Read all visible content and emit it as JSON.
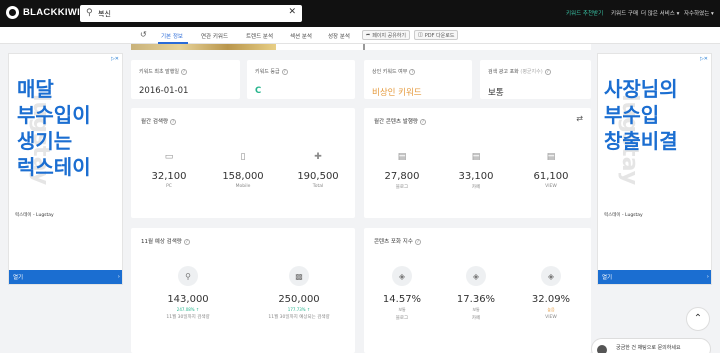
{
  "app": {
    "name": "BLACKKIWI"
  },
  "search": {
    "value": "복신",
    "placeholder": ""
  },
  "topnav": [
    {
      "label": "키워드 추천받기",
      "active": true
    },
    {
      "label": "키워드 구매"
    },
    {
      "label": "더 많은 서비스 ▾"
    },
    {
      "label": "자수하였는 ▾"
    }
  ],
  "tabs": [
    "기본 정보",
    "연관 키워드",
    "트렌드 분석",
    "섹션 분석",
    "성장 분석"
  ],
  "tab_buttons": [
    "페이지 공유하기",
    "PDF 다운로드"
  ],
  "ad_left": {
    "headline": "매달 부수입이 생기는 럭스테이",
    "headline_lines": [
      "매달",
      "부수입이",
      "생기는",
      "럭스테이"
    ],
    "sponsor": "럭스테이 - Lugstay",
    "button": "열기",
    "watermark": "lugstay"
  },
  "ad_right": {
    "headline": "사장님의 부수입 창출비결",
    "headline_lines": [
      "사장님의",
      "부수입",
      "창출비결"
    ],
    "sponsor": "럭스테이 - Lugstay",
    "button": "열기",
    "watermark": "lugstay"
  },
  "info_cards": [
    {
      "label": "키워드 최초 발행일",
      "value": "2016-01-01"
    },
    {
      "label": "키워드 등급",
      "value": "C"
    },
    {
      "label": "상인 키워드 여부",
      "value": "비상인 키워드"
    },
    {
      "label": "검색 광고 포화",
      "label2": "(평균지수)",
      "value": "보통"
    }
  ],
  "monthly_search": {
    "title": "월간 검색량",
    "items": [
      {
        "icon": "desktop-icon",
        "value": "32,100",
        "label": "PC"
      },
      {
        "icon": "mobile-icon",
        "value": "158,000",
        "label": "Mobile"
      },
      {
        "icon": "plus-icon",
        "value": "190,500",
        "label": "Total"
      }
    ]
  },
  "monthly_content": {
    "title": "월간 콘텐츠 발행량",
    "items": [
      {
        "icon": "document-icon",
        "value": "27,800",
        "label": "블로그"
      },
      {
        "icon": "document-icon",
        "value": "33,100",
        "label": "카페"
      },
      {
        "icon": "document-icon",
        "value": "61,100",
        "label": "VIEW"
      }
    ]
  },
  "forecast": {
    "title": "11월 예상 검색량",
    "items": [
      {
        "icon": "search-icon",
        "value": "143,000",
        "change": "247.08% ↑",
        "label": "11월 30일까지 검색량"
      },
      {
        "icon": "bar-chart-icon",
        "value": "250,000",
        "change": "177.73% ↑",
        "label": "11월 30일까지 예상되는 검색량"
      }
    ]
  },
  "saturation": {
    "title": "콘텐츠 포화 지수",
    "items": [
      {
        "icon": "layers-icon",
        "value": "14.57%",
        "grade": "보통",
        "label": "블로그"
      },
      {
        "icon": "layers-icon",
        "value": "17.36%",
        "grade": "보통",
        "label": "카페"
      },
      {
        "icon": "layers-icon",
        "value": "32.09%",
        "grade": "높음",
        "label": "VIEW"
      }
    ]
  },
  "chat": {
    "label": "궁금한 건 채팅으로 문의하세요"
  },
  "colors": {
    "accent": "#2a6bd8",
    "green": "#25b48c",
    "orange": "#e59a3c",
    "ad_blue": "#1b6ed1"
  }
}
